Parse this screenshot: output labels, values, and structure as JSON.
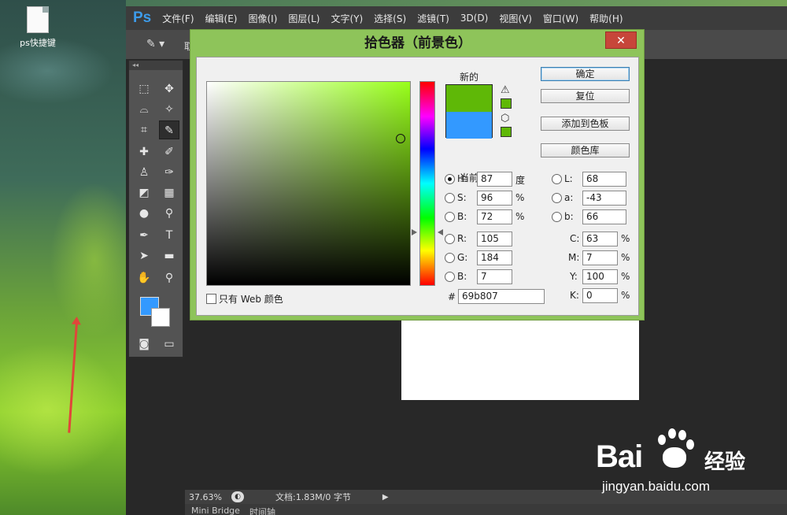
{
  "desktop": {
    "icon_label": "ps快捷键"
  },
  "app": {
    "logo": "Ps",
    "menu": [
      "文件(F)",
      "编辑(E)",
      "图像(I)",
      "图层(L)",
      "文字(Y)",
      "选择(S)",
      "滤镜(T)",
      "3D(D)",
      "视图(V)",
      "窗口(W)",
      "帮助(H)"
    ],
    "options_label": "取",
    "toolbar_header": "◂◂",
    "foreground_color": "#3399ff",
    "background_color": "#ffffff"
  },
  "status": {
    "zoom": "37.63%",
    "doc_info": "文档:1.83M/0 字节"
  },
  "bottom_tabs": [
    "Mini Bridge",
    "时间轴"
  ],
  "dialog": {
    "title": "拾色器（前景色）",
    "close": "✕",
    "new_label": "新的",
    "current_label": "当前",
    "new_color": "#5fb807",
    "current_color": "#3399ff",
    "buttons": {
      "ok": "确定",
      "reset": "复位",
      "add_swatch": "添加到色板",
      "color_library": "颜色库"
    },
    "web_only": "只有 Web 颜色",
    "hsb": [
      {
        "label": "H:",
        "value": "87",
        "unit": "度",
        "selected": true
      },
      {
        "label": "S:",
        "value": "96",
        "unit": "%"
      },
      {
        "label": "B:",
        "value": "72",
        "unit": "%"
      }
    ],
    "rgb": [
      {
        "label": "R:",
        "value": "105"
      },
      {
        "label": "G:",
        "value": "184"
      },
      {
        "label": "B:",
        "value": "7"
      }
    ],
    "lab": [
      {
        "label": "L:",
        "value": "68"
      },
      {
        "label": "a:",
        "value": "-43"
      },
      {
        "label": "b:",
        "value": "66"
      }
    ],
    "cmyk": [
      {
        "label": "C:",
        "value": "63",
        "unit": "%"
      },
      {
        "label": "M:",
        "value": "7",
        "unit": "%"
      },
      {
        "label": "Y:",
        "value": "100",
        "unit": "%"
      },
      {
        "label": "K:",
        "value": "0",
        "unit": "%"
      }
    ],
    "hex_label": "#",
    "hex": "69b807"
  },
  "watermark": {
    "brand": "Bai",
    "brand2": "经验",
    "url": "jingyan.baidu.com"
  }
}
